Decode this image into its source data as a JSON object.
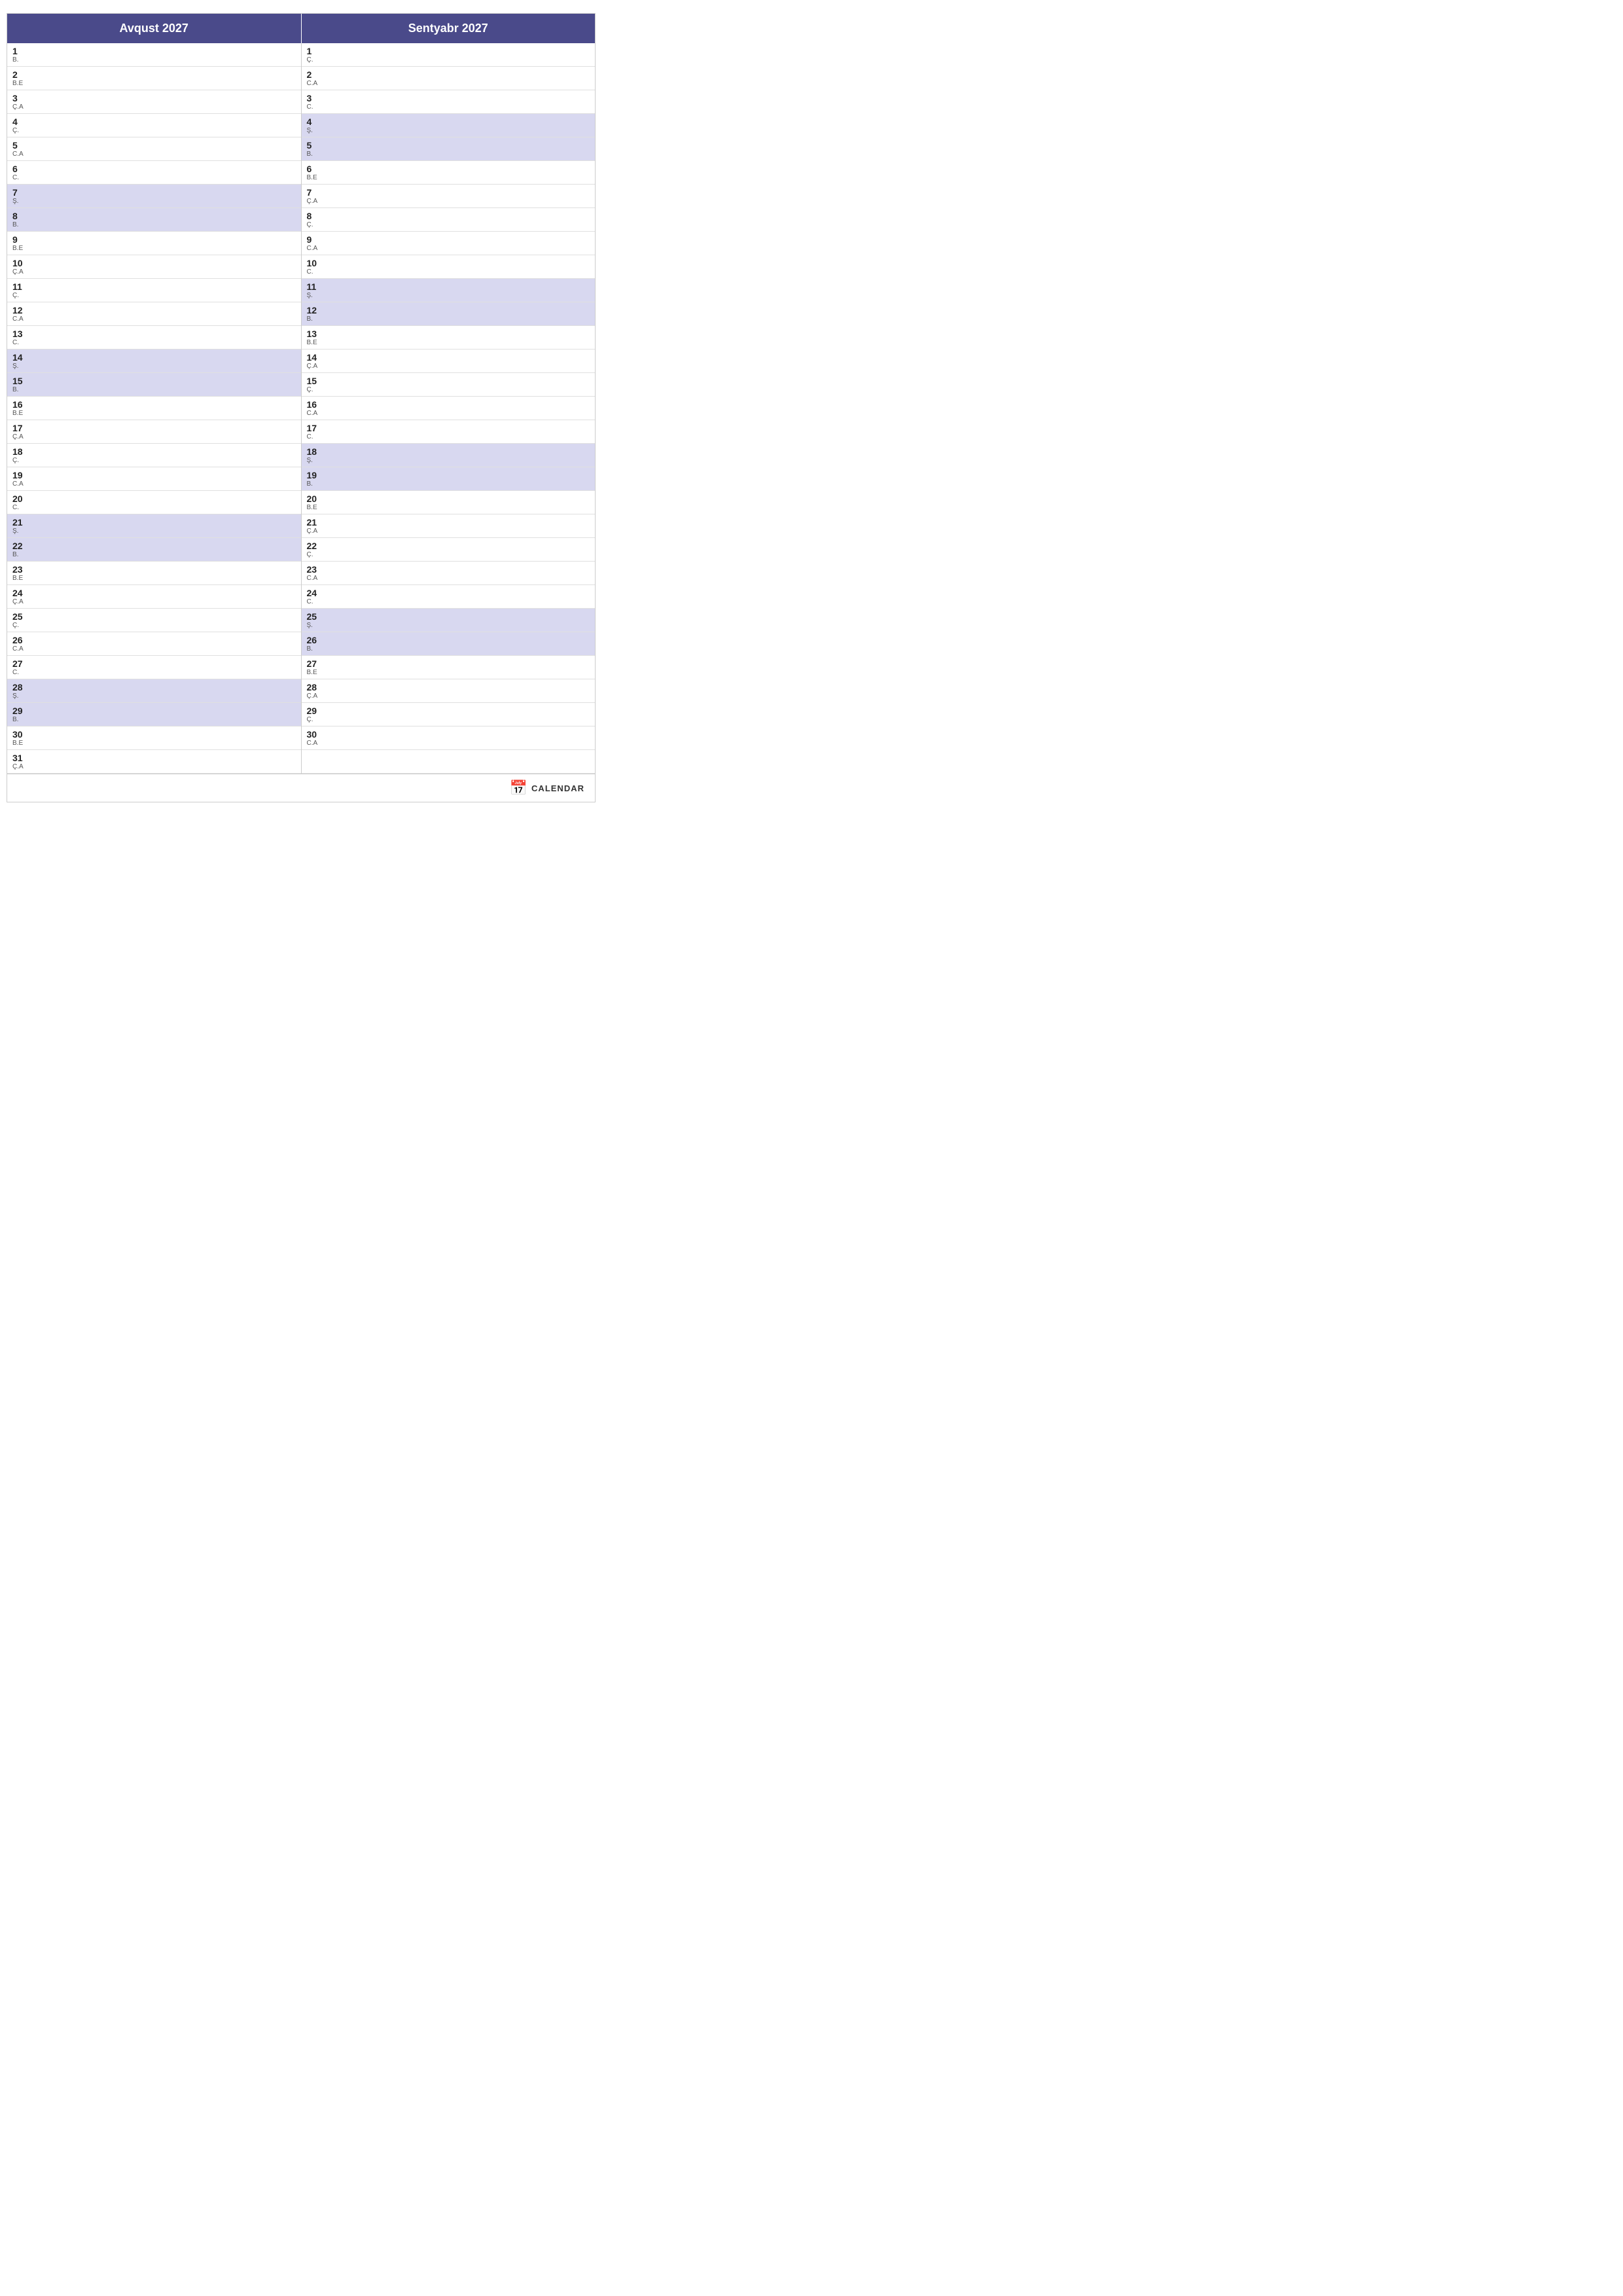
{
  "months": [
    {
      "name": "Avqust 2027",
      "days": [
        {
          "num": 1,
          "abbr": "B.",
          "weekend": false
        },
        {
          "num": 2,
          "abbr": "B.E",
          "weekend": false
        },
        {
          "num": 3,
          "abbr": "Ç.A",
          "weekend": false
        },
        {
          "num": 4,
          "abbr": "Ç.",
          "weekend": false
        },
        {
          "num": 5,
          "abbr": "C.A",
          "weekend": false
        },
        {
          "num": 6,
          "abbr": "C.",
          "weekend": false
        },
        {
          "num": 7,
          "abbr": "Ş.",
          "weekend": true
        },
        {
          "num": 8,
          "abbr": "B.",
          "weekend": true
        },
        {
          "num": 9,
          "abbr": "B.E",
          "weekend": false
        },
        {
          "num": 10,
          "abbr": "Ç.A",
          "weekend": false
        },
        {
          "num": 11,
          "abbr": "Ç.",
          "weekend": false
        },
        {
          "num": 12,
          "abbr": "C.A",
          "weekend": false
        },
        {
          "num": 13,
          "abbr": "C.",
          "weekend": false
        },
        {
          "num": 14,
          "abbr": "Ş.",
          "weekend": true
        },
        {
          "num": 15,
          "abbr": "B.",
          "weekend": true
        },
        {
          "num": 16,
          "abbr": "B.E",
          "weekend": false
        },
        {
          "num": 17,
          "abbr": "Ç.A",
          "weekend": false
        },
        {
          "num": 18,
          "abbr": "Ç.",
          "weekend": false
        },
        {
          "num": 19,
          "abbr": "C.A",
          "weekend": false
        },
        {
          "num": 20,
          "abbr": "C.",
          "weekend": false
        },
        {
          "num": 21,
          "abbr": "Ş.",
          "weekend": true
        },
        {
          "num": 22,
          "abbr": "B.",
          "weekend": true
        },
        {
          "num": 23,
          "abbr": "B.E",
          "weekend": false
        },
        {
          "num": 24,
          "abbr": "Ç.A",
          "weekend": false
        },
        {
          "num": 25,
          "abbr": "Ç.",
          "weekend": false
        },
        {
          "num": 26,
          "abbr": "C.A",
          "weekend": false
        },
        {
          "num": 27,
          "abbr": "C.",
          "weekend": false
        },
        {
          "num": 28,
          "abbr": "Ş.",
          "weekend": true
        },
        {
          "num": 29,
          "abbr": "B.",
          "weekend": true
        },
        {
          "num": 30,
          "abbr": "B.E",
          "weekend": false
        },
        {
          "num": 31,
          "abbr": "Ç.A",
          "weekend": false
        }
      ]
    },
    {
      "name": "Sentyabr 2027",
      "days": [
        {
          "num": 1,
          "abbr": "Ç.",
          "weekend": false
        },
        {
          "num": 2,
          "abbr": "C.A",
          "weekend": false
        },
        {
          "num": 3,
          "abbr": "C.",
          "weekend": false
        },
        {
          "num": 4,
          "abbr": "Ş.",
          "weekend": true
        },
        {
          "num": 5,
          "abbr": "B.",
          "weekend": true
        },
        {
          "num": 6,
          "abbr": "B.E",
          "weekend": false
        },
        {
          "num": 7,
          "abbr": "Ç.A",
          "weekend": false
        },
        {
          "num": 8,
          "abbr": "Ç.",
          "weekend": false
        },
        {
          "num": 9,
          "abbr": "C.A",
          "weekend": false
        },
        {
          "num": 10,
          "abbr": "C.",
          "weekend": false
        },
        {
          "num": 11,
          "abbr": "Ş.",
          "weekend": true
        },
        {
          "num": 12,
          "abbr": "B.",
          "weekend": true
        },
        {
          "num": 13,
          "abbr": "B.E",
          "weekend": false
        },
        {
          "num": 14,
          "abbr": "Ç.A",
          "weekend": false
        },
        {
          "num": 15,
          "abbr": "Ç.",
          "weekend": false
        },
        {
          "num": 16,
          "abbr": "C.A",
          "weekend": false
        },
        {
          "num": 17,
          "abbr": "C.",
          "weekend": false
        },
        {
          "num": 18,
          "abbr": "Ş.",
          "weekend": true
        },
        {
          "num": 19,
          "abbr": "B.",
          "weekend": true
        },
        {
          "num": 20,
          "abbr": "B.E",
          "weekend": false
        },
        {
          "num": 21,
          "abbr": "Ç.A",
          "weekend": false
        },
        {
          "num": 22,
          "abbr": "Ç.",
          "weekend": false
        },
        {
          "num": 23,
          "abbr": "C.A",
          "weekend": false
        },
        {
          "num": 24,
          "abbr": "C.",
          "weekend": false
        },
        {
          "num": 25,
          "abbr": "Ş.",
          "weekend": true
        },
        {
          "num": 26,
          "abbr": "B.",
          "weekend": true
        },
        {
          "num": 27,
          "abbr": "B.E",
          "weekend": false
        },
        {
          "num": 28,
          "abbr": "Ç.A",
          "weekend": false
        },
        {
          "num": 29,
          "abbr": "Ç.",
          "weekend": false
        },
        {
          "num": 30,
          "abbr": "C.A",
          "weekend": false
        }
      ]
    }
  ],
  "footer": {
    "icon": "7",
    "label": "CALENDAR"
  }
}
